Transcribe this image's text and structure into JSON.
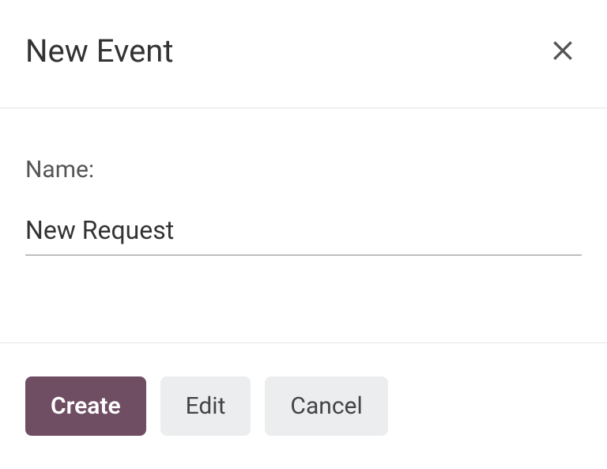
{
  "dialog": {
    "title": "New Event",
    "form": {
      "name_label": "Name:",
      "name_value": "New Request"
    },
    "actions": {
      "create_label": "Create",
      "edit_label": "Edit",
      "cancel_label": "Cancel"
    }
  },
  "colors": {
    "primary": "#6f4e63",
    "secondary_bg": "#ebedef",
    "border": "#e5e5e5",
    "text": "#333333",
    "muted_text": "#555555"
  }
}
